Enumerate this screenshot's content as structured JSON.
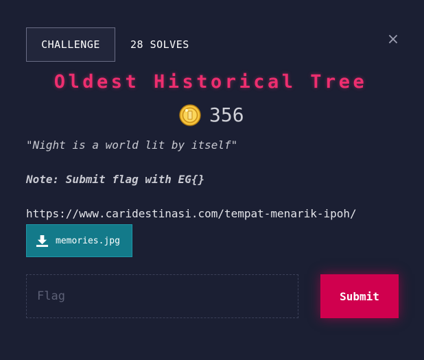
{
  "tabs": {
    "challenge": "CHALLENGE",
    "solves": "28 SOLVES"
  },
  "close_label": "×",
  "challenge": {
    "title": "Oldest Historical Tree",
    "points": "356",
    "quote": "\"Night is a world lit by itself\"",
    "note": "Note: Submit flag with EG{}",
    "url": "https://www.caridestinasi.com/tempat-menarik-ipoh/",
    "file": "memories.jpg"
  },
  "form": {
    "placeholder": "Flag",
    "value": "",
    "submit_label": "Submit"
  },
  "icons": {
    "coin": "coin-icon",
    "download": "download-icon"
  },
  "colors": {
    "background": "#1b1f33",
    "title": "#ee2e6f",
    "file_button": "#137a8a",
    "submit": "#d0004e",
    "coin": "#f5c33b"
  }
}
